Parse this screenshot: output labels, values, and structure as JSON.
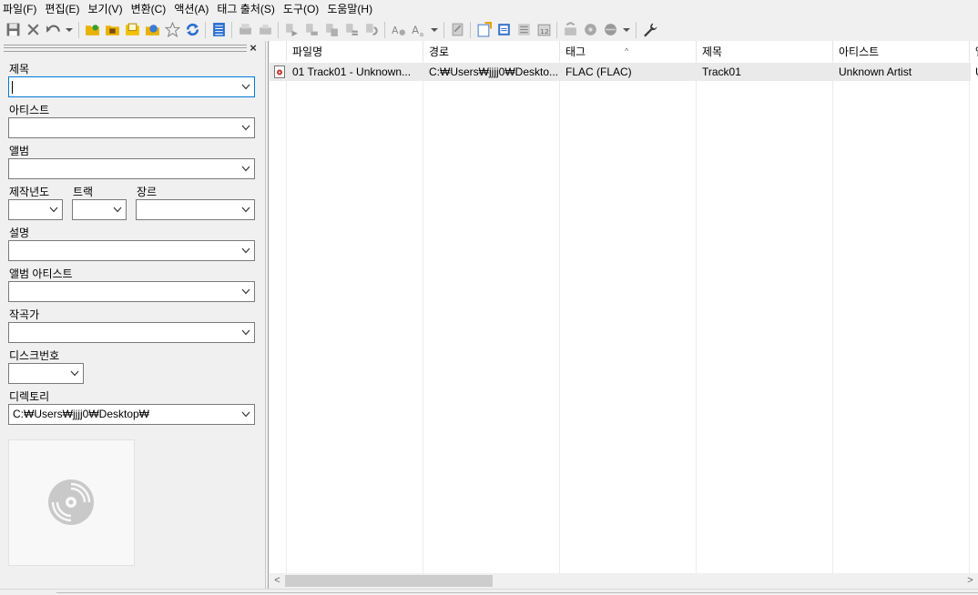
{
  "menu": [
    "파일(F)",
    "편집(E)",
    "보기(V)",
    "변환(C)",
    "액션(A)",
    "태그 출처(S)",
    "도구(O)",
    "도움말(H)"
  ],
  "toolbar": {
    "icons": [
      "save-icon",
      "remove-tag-icon",
      "undo-icon",
      "open-folder-icon",
      "add-folder-icon",
      "favorites-folder-icon",
      "playlist-icon",
      "star-icon",
      "refresh-icon",
      "list-icon",
      "tag-to-filename-icon",
      "filename-to-tag-icon",
      "web-source-icon",
      "export-icon",
      "wrench-icon"
    ]
  },
  "left_panel": {
    "close_glyph": "×",
    "fields": {
      "title": {
        "label": "제목",
        "value": ""
      },
      "artist": {
        "label": "아티스트",
        "value": ""
      },
      "album": {
        "label": "앨범",
        "value": ""
      },
      "year": {
        "label": "제작년도",
        "value": ""
      },
      "track": {
        "label": "트랙",
        "value": ""
      },
      "genre": {
        "label": "장르",
        "value": ""
      },
      "comment": {
        "label": "설명",
        "value": ""
      },
      "album_artist": {
        "label": "앨범 아티스트",
        "value": ""
      },
      "composer": {
        "label": "작곡가",
        "value": ""
      },
      "discnumber": {
        "label": "디스크번호",
        "value": ""
      },
      "directory": {
        "label": "디렉토리",
        "value": "C:₩Users₩jjjj0₩Desktop₩"
      }
    }
  },
  "list": {
    "columns": [
      "파일명",
      "경로",
      "태그",
      "제목",
      "아티스트",
      "앨"
    ],
    "sort_glyph": "^",
    "rows": [
      {
        "filename": "01 Track01 - Unknown...",
        "path": "C:₩Users₩jjjj0₩Deskto...",
        "tag": "FLAC (FLAC)",
        "title": "Track01",
        "artist": "Unknown Artist",
        "album": "U"
      }
    ]
  },
  "scroll": {
    "left": "<",
    "right": ">"
  }
}
